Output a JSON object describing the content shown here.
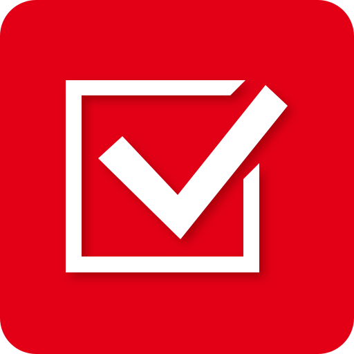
{
  "icon": {
    "name": "checkbox-checked-icon",
    "colors": {
      "background": "#E30016",
      "foreground": "#FFFFFF",
      "shadow": "#7A000B"
    }
  }
}
